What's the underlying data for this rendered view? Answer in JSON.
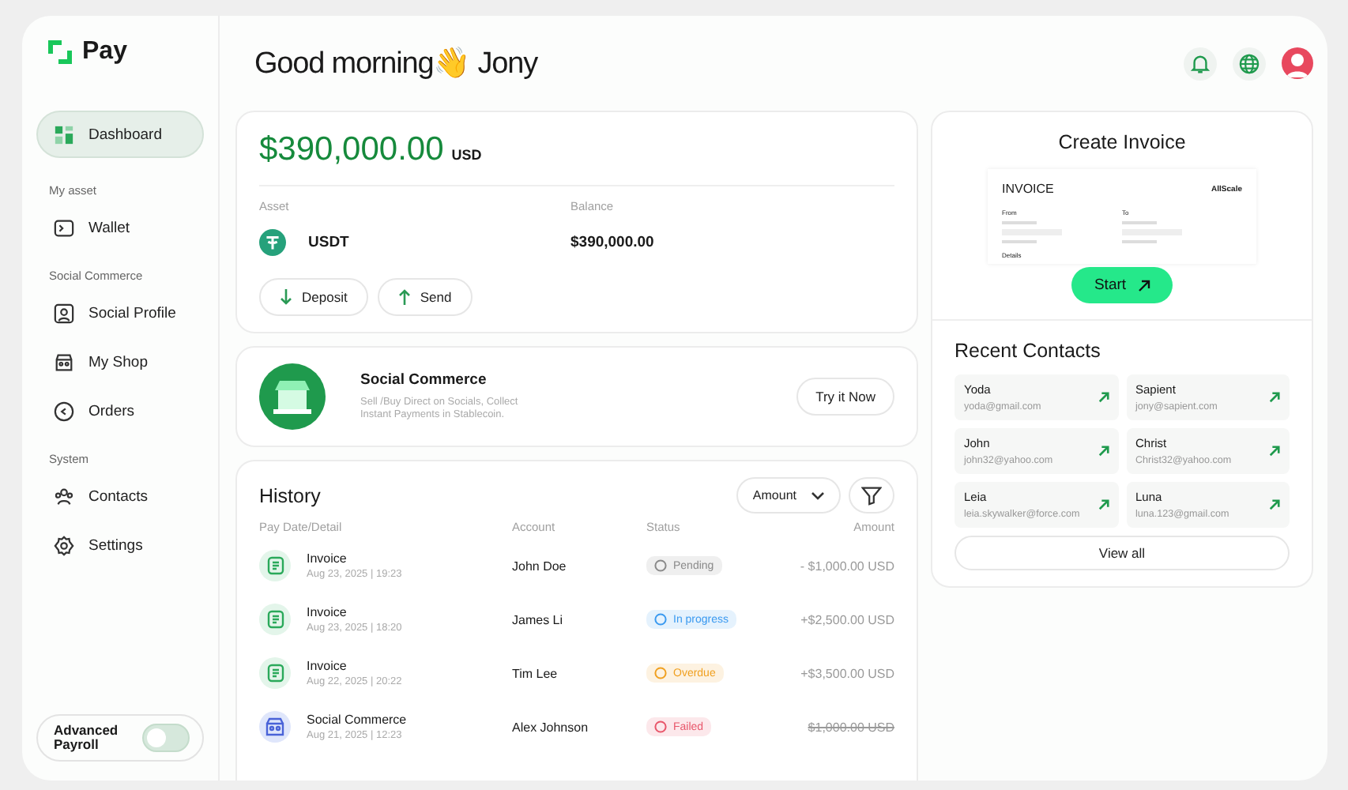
{
  "brand": {
    "name": "Pay"
  },
  "sidebar": {
    "items": [
      {
        "kind": "dashboard",
        "label": "Dashboard",
        "selected": true
      },
      {
        "kind": "section",
        "label": "My asset"
      },
      {
        "kind": "wallet",
        "label": "Wallet",
        "selected": false
      },
      {
        "kind": "section",
        "label": "Social Commerce"
      },
      {
        "kind": "profile",
        "label": "Social Profile",
        "selected": false
      },
      {
        "kind": "shop",
        "label": "My Shop",
        "selected": false
      },
      {
        "kind": "orders",
        "label": "Orders",
        "selected": false
      },
      {
        "kind": "section",
        "label": "System"
      },
      {
        "kind": "contacts",
        "label": "Contacts",
        "selected": false
      },
      {
        "kind": "settings",
        "label": "Settings",
        "selected": false
      }
    ],
    "toggle": {
      "label": "Advanced Payroll",
      "on": false
    }
  },
  "header": {
    "greeting": "Good morning",
    "emoji": "👋",
    "name": "Jony"
  },
  "balance": {
    "amount": "$390,000.00",
    "currency": "USD",
    "columns": [
      "Asset",
      "Balance"
    ],
    "asset": "USDT",
    "asset_balance": "$390,000.00",
    "buttons": [
      {
        "label": "Deposit",
        "kind": "deposit"
      },
      {
        "label": "Send",
        "kind": "send"
      }
    ]
  },
  "promo": {
    "title": "Social Commerce",
    "text": "Sell /Buy Direct on Socials, Collect Instant Payments in Stablecoin.",
    "button": "Try it Now"
  },
  "history": {
    "title": "History",
    "sort": "Amount",
    "columns": [
      "Pay Date/Detail",
      "Account",
      "Status",
      "Amount"
    ],
    "rows": [
      {
        "kind": "invoice",
        "title": "Invoice",
        "date": "Aug 23, 2025 | 19:23",
        "account": "John Doe",
        "status": "Pending",
        "color": "#8a8a8a",
        "amount": "- $1,000.00 USD",
        "struck": false
      },
      {
        "kind": "invoice",
        "title": "Invoice",
        "date": "Aug 23, 2025 | 18:20",
        "account": "James Li",
        "status": "In progress",
        "color": "#3b9af0",
        "amount": "+$2,500.00 USD",
        "struck": false
      },
      {
        "kind": "invoice",
        "title": "Invoice",
        "date": "Aug 22, 2025 | 20:22",
        "account": "Tim Lee",
        "status": "Overdue",
        "color": "#f0a020",
        "amount": "+$3,500.00 USD",
        "struck": false
      },
      {
        "kind": "social",
        "title": "Social Commerce",
        "date": "Aug 21, 2025 | 12:23",
        "account": "Alex Johnson",
        "status": "Failed",
        "color": "#e8566a",
        "amount": "$1,000.00 USD",
        "struck": true
      }
    ]
  },
  "invoice": {
    "title": "Create Invoice",
    "doc_title": "INVOICE",
    "logo": "AllScale",
    "from": "From",
    "to": "To",
    "details": "Details",
    "button": "Start"
  },
  "contacts": {
    "title": "Recent Contacts",
    "items": [
      {
        "name": "Yoda",
        "email": "yoda@gmail.com"
      },
      {
        "name": "Sapient",
        "email": "jony@sapient.com"
      },
      {
        "name": "John",
        "email": "john32@yahoo.com"
      },
      {
        "name": "Christ",
        "email": "Christ32@yahoo.com"
      },
      {
        "name": "Leia",
        "email": "leia.skywalker@force.com"
      },
      {
        "name": "Luna",
        "email": "luna.123@gmail.com"
      }
    ],
    "button": "View all"
  }
}
